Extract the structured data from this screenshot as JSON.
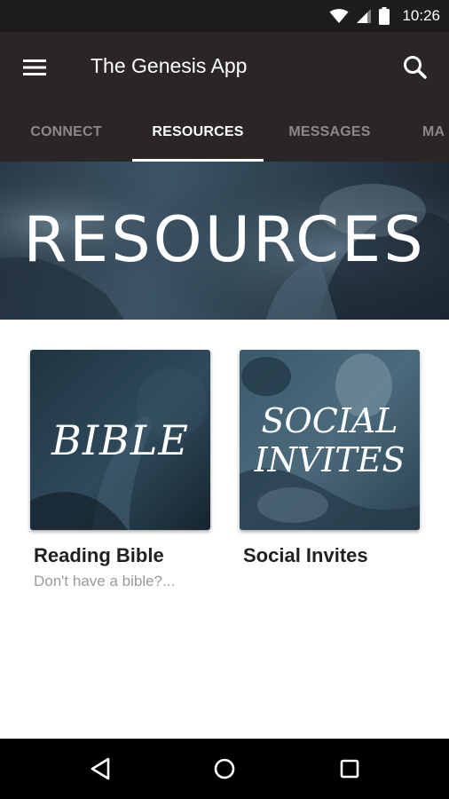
{
  "status_bar": {
    "time": "10:26",
    "icons": [
      "wifi-icon",
      "signal-icon",
      "battery-icon"
    ]
  },
  "app_bar": {
    "title": "The Genesis App",
    "menu_icon": "hamburger-menu-icon",
    "search_icon": "search-icon"
  },
  "tabs": [
    {
      "label": "CONNECT",
      "active": false
    },
    {
      "label": "RESOURCES",
      "active": true
    },
    {
      "label": "MESSAGES",
      "active": false
    },
    {
      "label": "MA",
      "active": false
    }
  ],
  "hero": {
    "title": "RESOURCES"
  },
  "cards": [
    {
      "image_text": "BIBLE",
      "title": "Reading Bible",
      "subtitle": "Don't have a bible?..."
    },
    {
      "image_text_line1": "SOCIAL",
      "image_text_line2": "INVITES",
      "title": "Social Invites",
      "subtitle": ""
    }
  ],
  "nav_bar": {
    "icons": [
      "back-icon",
      "home-icon",
      "recents-icon"
    ]
  },
  "colors": {
    "status_bar": "#1f1c1c",
    "app_bar": "#2a2626",
    "tab_inactive": "#8c8888",
    "tab_active": "#ffffff",
    "card_tint": "#2c4656"
  }
}
